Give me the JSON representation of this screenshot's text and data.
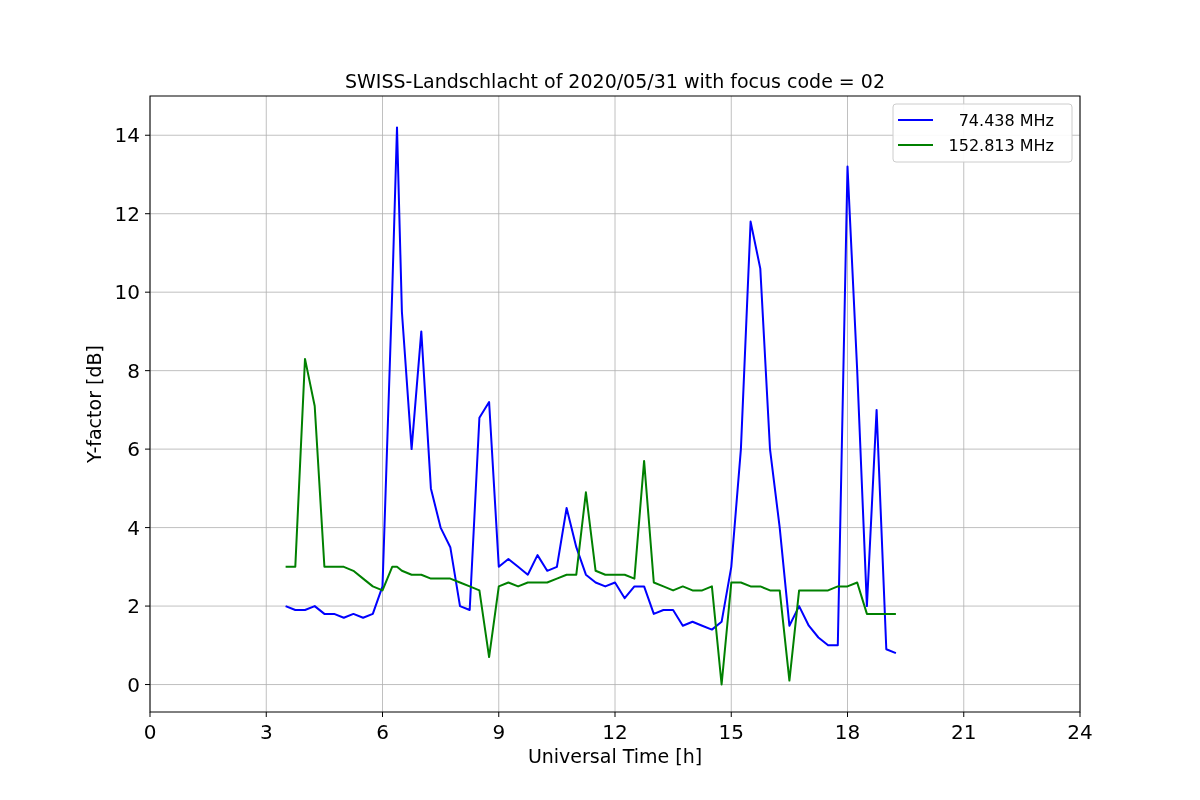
{
  "figure": {
    "chart_data": {
      "type": "line",
      "title": "SWISS-Landschlacht of 2020/05/31 with focus code = 02",
      "xlabel": "Universal Time [h]",
      "ylabel": "Y-factor [dB]",
      "xlim": [
        0,
        24
      ],
      "ylim": [
        -0.7,
        15
      ],
      "xticks": [
        0,
        3,
        6,
        9,
        12,
        15,
        18,
        21,
        24
      ],
      "grid": true,
      "legend": true,
      "yticks": [
        0,
        2,
        4,
        6,
        8,
        10,
        12,
        14
      ],
      "x": [
        3.5,
        3.75,
        4.0,
        4.25,
        4.5,
        4.75,
        5.0,
        5.25,
        5.5,
        5.75,
        6.0,
        6.25,
        6.375,
        6.5,
        6.75,
        7.0,
        7.25,
        7.5,
        7.75,
        8.0,
        8.25,
        8.5,
        8.75,
        9.0,
        9.25,
        9.5,
        9.75,
        10.0,
        10.25,
        10.5,
        10.75,
        11.0,
        11.25,
        11.5,
        11.75,
        12.0,
        12.25,
        12.5,
        12.75,
        13.0,
        13.25,
        13.5,
        13.75,
        14.0,
        14.25,
        14.5,
        14.75,
        15.0,
        15.25,
        15.5,
        15.75,
        16.0,
        16.25,
        16.5,
        16.75,
        17.0,
        17.25,
        17.5,
        17.75,
        18.0,
        18.25,
        18.5,
        18.75,
        19.0,
        19.25
      ],
      "series": [
        {
          "name": "74.438 MHz",
          "color": "#0000ff",
          "values": [
            2.0,
            1.9,
            1.9,
            2.0,
            1.8,
            1.8,
            1.7,
            1.8,
            1.7,
            1.8,
            2.5,
            10.0,
            14.2,
            9.5,
            6.0,
            9.0,
            5.0,
            4.0,
            3.5,
            2.0,
            1.9,
            6.8,
            7.2,
            3.0,
            3.2,
            3.0,
            2.8,
            3.3,
            2.9,
            3.0,
            4.5,
            3.5,
            2.8,
            2.6,
            2.5,
            2.6,
            2.2,
            2.5,
            2.5,
            1.8,
            1.9,
            1.9,
            1.5,
            1.6,
            1.5,
            1.4,
            1.6,
            3.0,
            6.0,
            11.8,
            10.6,
            6.0,
            4.0,
            1.5,
            2.0,
            1.5,
            1.2,
            1.0,
            1.0,
            13.2,
            8.0,
            2.0,
            7.0,
            0.9,
            0.8
          ]
        },
        {
          "name": "152.813 MHz",
          "color": "#008000",
          "values": [
            3.0,
            3.0,
            8.3,
            7.1,
            3.0,
            3.0,
            3.0,
            2.9,
            2.7,
            2.5,
            2.4,
            3.0,
            3.0,
            2.9,
            2.8,
            2.8,
            2.7,
            2.7,
            2.7,
            2.6,
            2.5,
            2.4,
            0.7,
            2.5,
            2.6,
            2.5,
            2.6,
            2.6,
            2.6,
            2.7,
            2.8,
            2.8,
            4.9,
            2.9,
            2.8,
            2.8,
            2.8,
            2.7,
            5.7,
            2.6,
            2.5,
            2.4,
            2.5,
            2.4,
            2.4,
            2.5,
            0.0,
            2.6,
            2.6,
            2.5,
            2.5,
            2.4,
            2.4,
            0.1,
            2.4,
            2.4,
            2.4,
            2.4,
            2.5,
            2.5,
            2.6,
            1.8,
            1.8,
            1.8,
            1.8
          ]
        }
      ]
    }
  }
}
